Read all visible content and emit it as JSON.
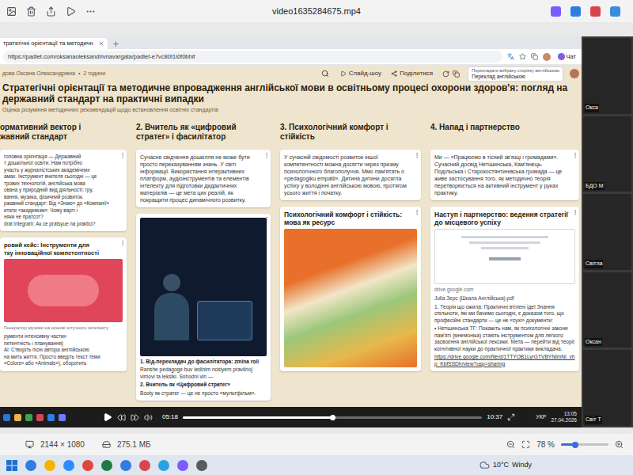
{
  "window": {
    "title": "video1635284675.mp4"
  },
  "browser": {
    "tab": "тратегічні орієнтації та методичн",
    "url": "https://padlet.com/oksanaoleksandrivnavargata/padlet-e7vc80t1i0f0bhif",
    "chat": "Чат"
  },
  "padlet": {
    "author": "дова Оксана Олександрівна",
    "separator": "•",
    "time": "2 години",
    "slideshow": "Слайд-шоу",
    "share": "Поділитися",
    "translate": {
      "line1": "Перекладати вибрану сторінку англійською",
      "line2": "Переклад англійською"
    },
    "title": "Стратегічні орієнтації та методичне впровадження англійської мови в освітньому процесі охорони здоров'я: погляд на державний стандарт на практичні випадки",
    "subtitle": "Оцінка розуміння методичних рекомендацій щодо встановлення освітніх стандартів"
  },
  "columns": [
    {
      "title_lines": [
        "ормативний вектор і",
        "жавний стандарт"
      ],
      "cards": [
        {
          "image": false,
          "lines": [
            "головна орієнтація — Державний",
            "т дошкільної освіти. Нам потрібно",
            "участь у журналістських академічних",
            "амах. Інструмент вчителя сьогодні — це",
            "трових технологій, англійська мова",
            "ована у природний вид діяльності: гру,",
            "вання, музика, фізичний розвиток.",
            "ржавний стандарт: Від «Знаю» до «Компанії»",
            "итати «академізм»: Чому варті і",
            "няки не пратсот?",
            "drat integrarii: Ак се pratsyue na praktici?"
          ]
        },
        {
          "image": true,
          "title_lines": [
            "ровий кейс: Інструменти для",
            "тку інноваційної компетентності"
          ],
          "caption": "Генератор музики на основі штучного інтелекту",
          "lines": [
            "рументи інтенсивну частин",
            "петентність і планування)",
            "Ai: Створіть пісні автора англійською",
            "на мить життя. Просто введіть текст теми",
            "«Colors» або «Animals»), оборотить"
          ]
        }
      ]
    },
    {
      "title_lines": [
        "2. Вчитель як «цифровий",
        "стратег» і фасилітатор"
      ],
      "cards": [
        {
          "image": false,
          "text": "Сучасне свідчення дошкілля не може бути просто переказуванням знань. У світі інформації. Використання інтерактивних платформ, аудіоінструментів та елементів інтелекту для підготовки дидактичних матеріалів — це мета цих реалій, як покращити процес динамічного розвитку."
        },
        {
          "image": true,
          "paragraphs": [
            {
              "text": "1. Від-перекладач до фасилітатора: zmina roli",
              "strong": true,
              "link": false
            },
            {
              "text": "Ranshe pedagoge buv iedinim nosiyem pravilnoj vimovi ta leksiki. Sohodni vin —",
              "strong": false,
              "link": false
            },
            {
              "text": "2. Вчитель як «Цифровий стратег»",
              "strong": true,
              "link": false
            },
            {
              "text": "Booty як стратег — це не просто «мультфільм».",
              "strong": false,
              "link": false
            }
          ]
        }
      ]
    },
    {
      "title_lines": [
        "3. Психологічний комфорт і",
        "стійкість"
      ],
      "cards": [
        {
          "image": false,
          "text": "У сучасній свідомості розвиток іншої компетентності можна досягти через призму психологічного благополуччя. Ммо пам'ятать о «pedagogiku empatii». Дитина дитини досягла успіху у володінні англійською мовою, протягом усього життя і початку."
        },
        {
          "image": true,
          "title": "Психологічний комфорт і стійкість: мова як ресурс"
        }
      ]
    },
    {
      "title_lines": [
        "4. Напад і партнерство"
      ],
      "cards": [
        {
          "image": false,
          "text": "Ми — «Працюємо в тісний зв'язці і громадами». Сучасний досвід Нетішинська, Кам'янець-Подільська і Старокостянтинівська громада — це живе застосування того, як методично теорія перетворюється на активний інструмент у руках практику."
        },
        {
          "image": true,
          "title": "Наступ і партнерство: ведення стратегії до місцевого успіху",
          "source": "drive.google.com",
          "file": "Julia Зерс (Шкала Англійська).pdf",
          "paragraphs": [
            {
              "text": "1. Теорія що ожила: Практичні втілені ідеї Знання спільноти, які ми бачимо сьогодні, є доказом того, що професійні стандарти — це не «сухі» документи:",
              "strong": false,
              "link": false
            },
            {
              "text": "• Нетішинська ТГ: Покажіть нам, як психологічні закони пам'яті (мнемоніка) стають інструментом для легкого засвоєння англійської лексики. Мета — перейти від теорії когнітивної науки до практичної практики викладача.",
              "strong": false,
              "link": false
            },
            {
              "text": "https://drive.google.com/file/d/1TTYOB1LyrGTVBYNImNI_vhp_KbfSSDh/view?usp=sharing",
              "strong": false,
              "link": true
            }
          ]
        }
      ]
    }
  ],
  "player": {
    "elapsed": "05:18",
    "total": "10:37",
    "level": 0.5,
    "lang": "УКР",
    "clock": "13:05",
    "date": "27.04.2026"
  },
  "participants": [
    {
      "name": "Окса"
    },
    {
      "name": "БДО М"
    },
    {
      "name": "Світла"
    },
    {
      "name": "Оксан"
    },
    {
      "name": "Світ Т"
    }
  ],
  "status_bar": {
    "dimensions": "2144 × 1080",
    "size": "275.1 МБ",
    "zoom": "78 %",
    "zoom_level": 0.3
  },
  "taskbar": {
    "temperature": "10°C",
    "weather": "Windy"
  }
}
